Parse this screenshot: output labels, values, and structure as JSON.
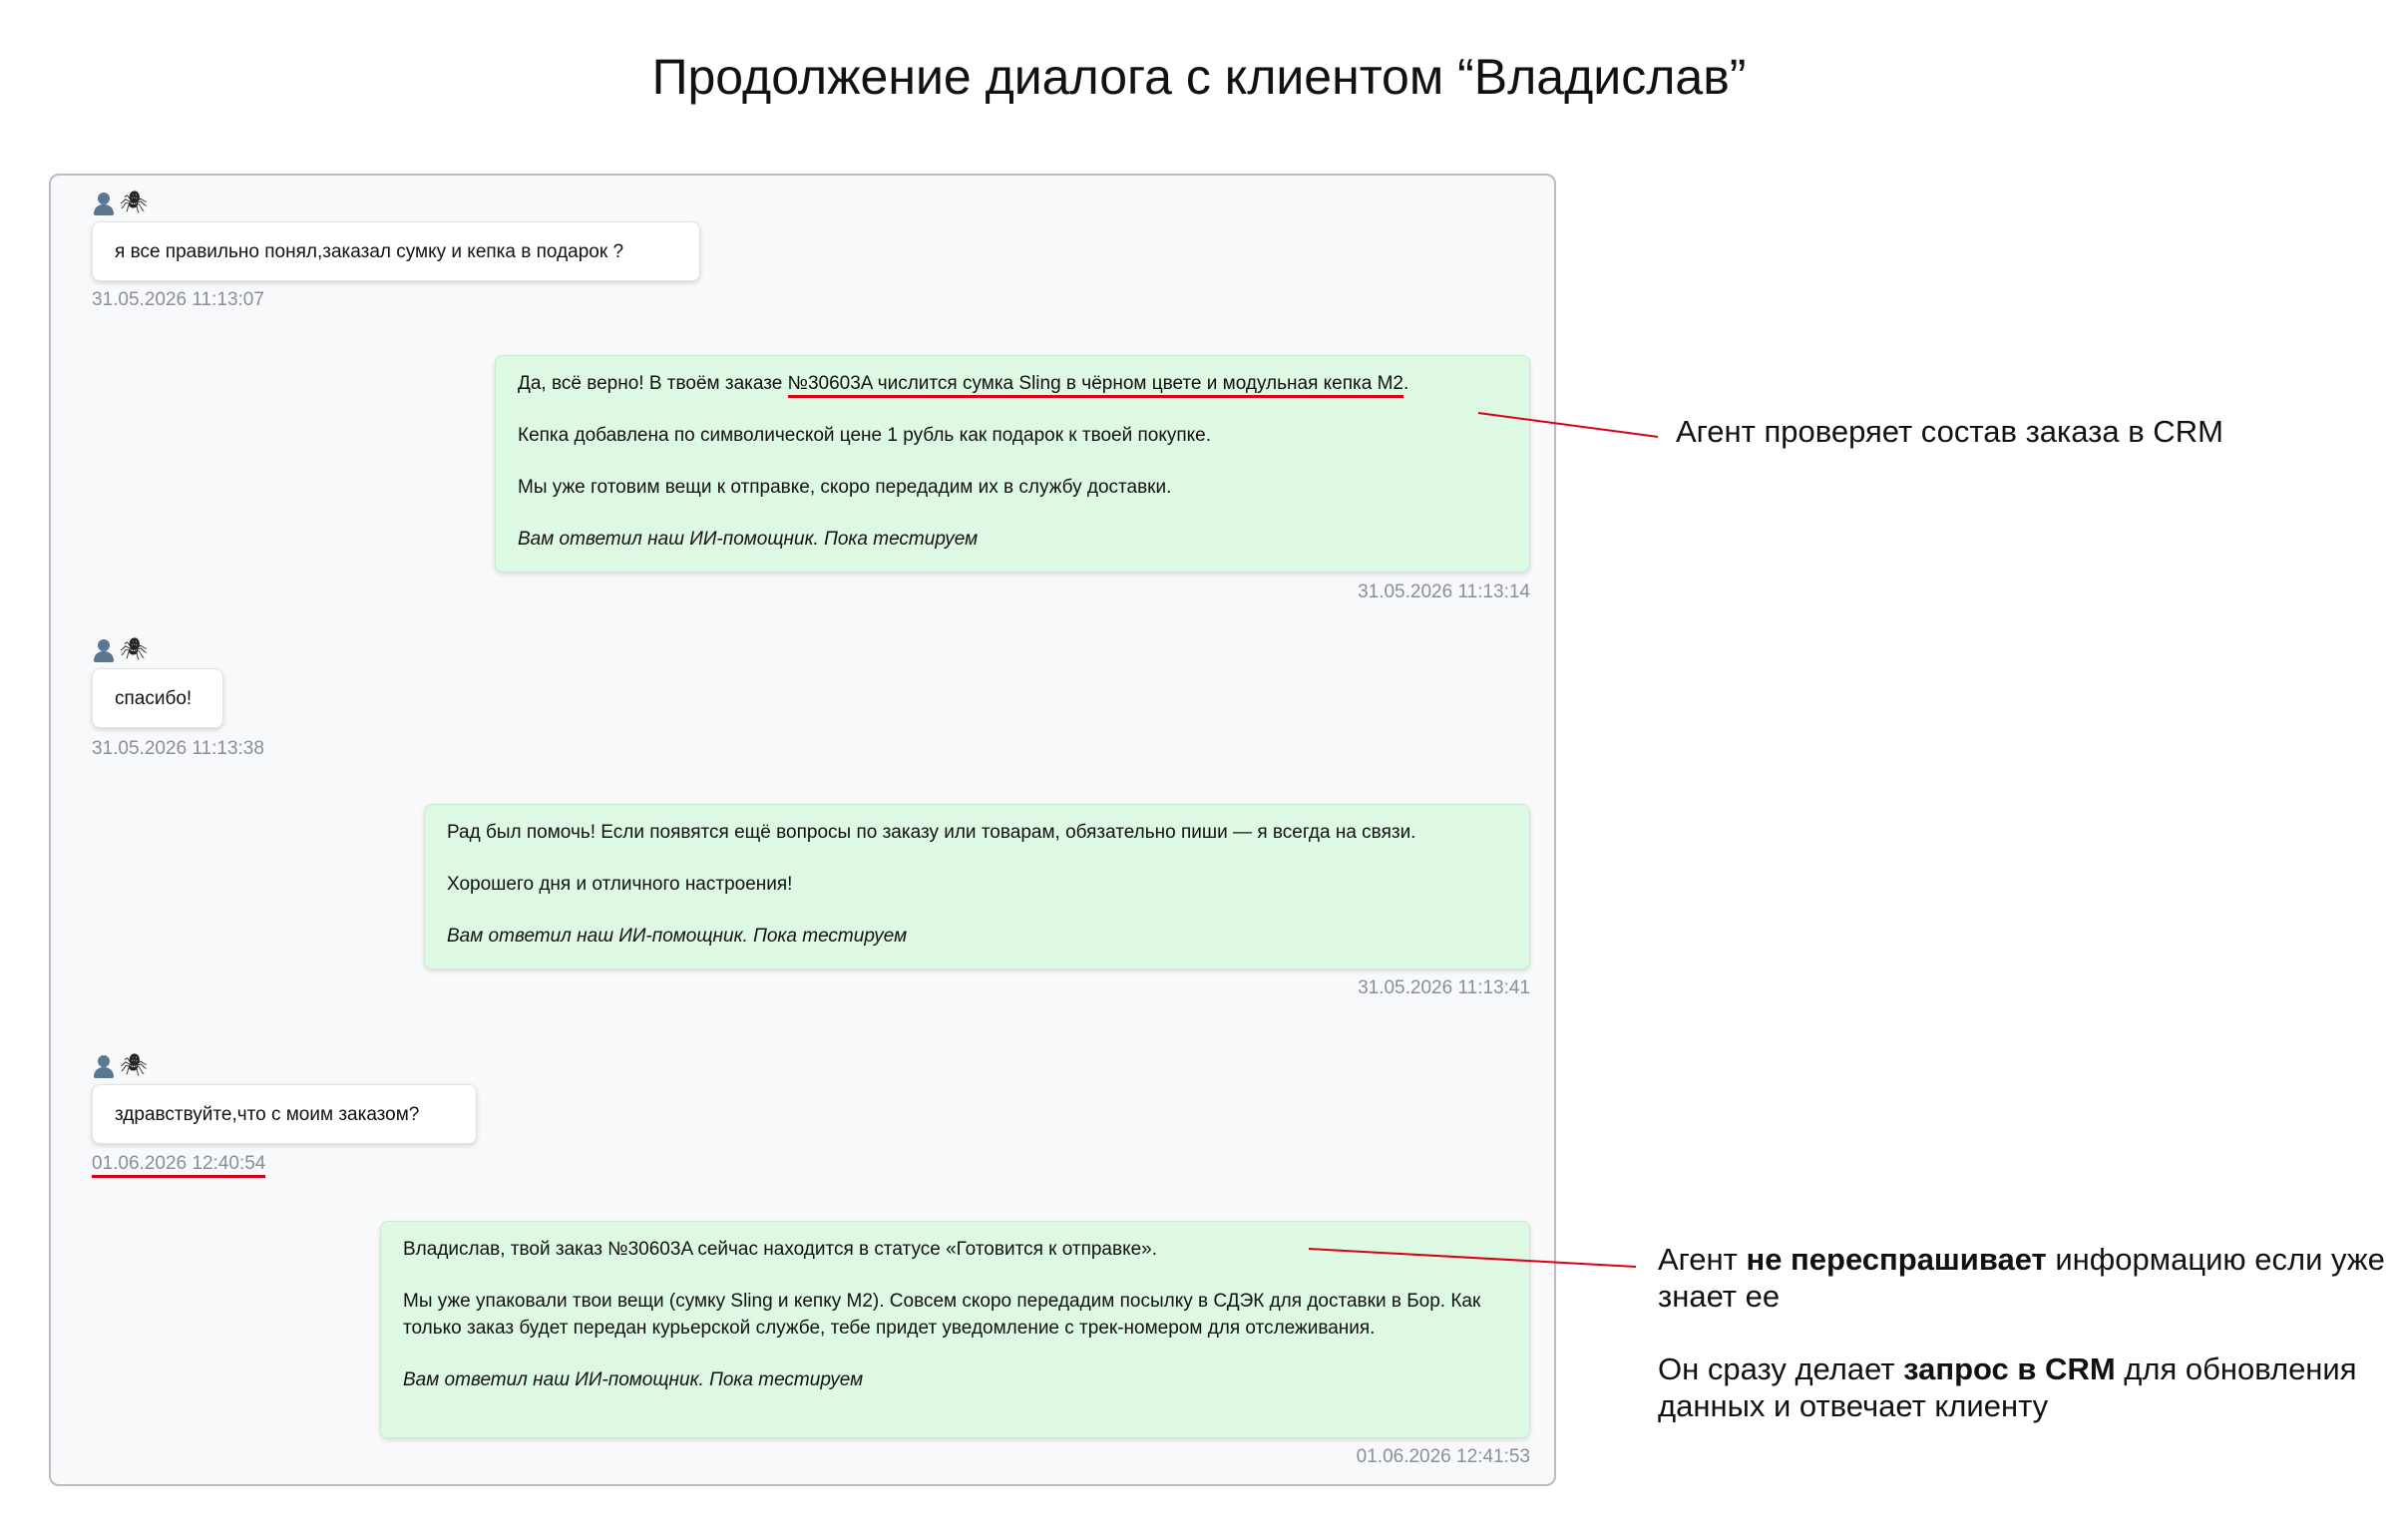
{
  "page_title": "Продолжение диалога с клиентом “Владислав”",
  "colors": {
    "client_bubble": "#ffffff",
    "agent_bubble": "#ddf9e3",
    "annotation_line": "#d70015",
    "timestamp": "#8a8f95"
  },
  "chat": {
    "messages": [
      {
        "sender": "client",
        "icons": [
          "user-icon",
          "spider-icon"
        ],
        "text": "я все правильно понял,заказал сумку и кепка в подарок ?",
        "time": "31.05.2026 11:13:07"
      },
      {
        "sender": "agent",
        "lines": [
          {
            "pre": "Да, всё верно! В твоём заказе ",
            "highlight": "№30603A числится сумка Sling в чёрном цвете и модульная кепка M2",
            "post": "."
          },
          "Кепка добавлена по символической цене 1 рубль как подарок к твоей покупке.",
          "Мы уже готовим вещи к отправке, скоро передадим их в службу доставки."
        ],
        "signature": "Вам ответил наш ИИ-помощник. Пока тестируем",
        "time": "31.05.2026 11:13:14"
      },
      {
        "sender": "client",
        "icons": [
          "user-icon",
          "spider-icon"
        ],
        "text": "спасибо!",
        "time": "31.05.2026 11:13:38"
      },
      {
        "sender": "agent",
        "lines": [
          "Рад был помочь! Если появятся ещё вопросы по заказу или товарам, обязательно пиши — я всегда на связи.",
          "Хорошего дня и отличного настроения!"
        ],
        "signature": "Вам ответил наш ИИ-помощник. Пока тестируем",
        "time": "31.05.2026 11:13:41"
      },
      {
        "sender": "client",
        "icons": [
          "user-icon",
          "spider-icon"
        ],
        "text": "здравствуйте,что с моим заказом?",
        "time": "01.06.2026 12:40:54"
      },
      {
        "sender": "agent",
        "lines": [
          "Владислав, твой заказ №30603A сейчас находится в статусе «Готовится к отправке».",
          "Мы уже упаковали твои вещи (сумку Sling и кепку M2). Совсем скоро передадим посылку в СДЭК для доставки в Бор. Как только заказ будет передан курьерской службе, тебе придет уведомление с трек-номером для отслеживания."
        ],
        "signature": "Вам ответил наш ИИ-помощник. Пока тестируем",
        "time": "01.06.2026 12:41:53"
      }
    ]
  },
  "annotations": {
    "crm_check": "Агент проверяет состав заказа в CRM",
    "no_reask": {
      "p1_pre": "Агент ",
      "p1_bold": "не переспрашивает",
      "p1_post": " информацию если уже знает ее",
      "p2_pre": "Он сразу делает ",
      "p2_bold": "запрос в CRM",
      "p2_post": " для обновления данных и отвечает клиенту"
    }
  }
}
